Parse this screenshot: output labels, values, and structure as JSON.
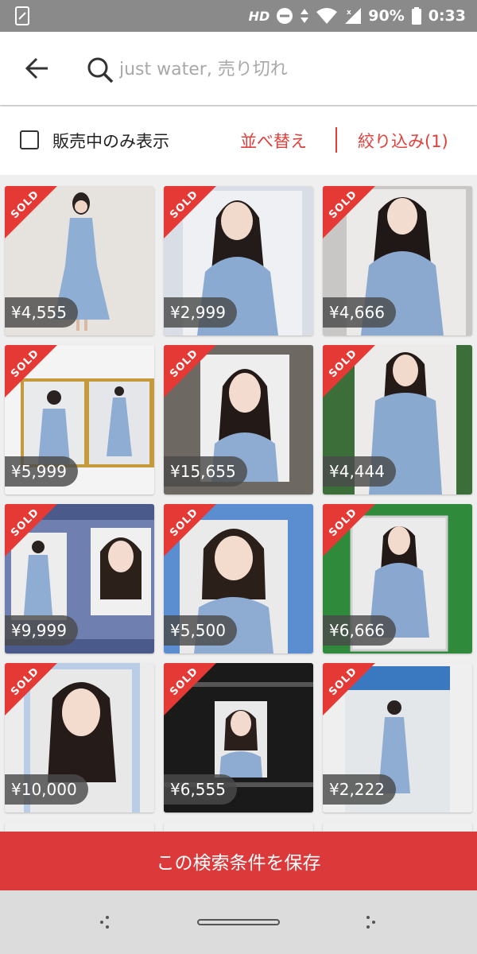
{
  "status_bar": {
    "hd": "HD",
    "battery": "90%",
    "time": "0:33"
  },
  "search": {
    "placeholder": "just water, 売り切れ"
  },
  "filter_bar": {
    "checkbox_label": "販売中のみ表示",
    "sort_label": "並べ替え",
    "filter_label": "絞り込み(1)",
    "accent_color": "#e0403b"
  },
  "items": [
    {
      "sold": "SOLD",
      "price": "¥4,555"
    },
    {
      "sold": "SOLD",
      "price": "¥2,999"
    },
    {
      "sold": "SOLD",
      "price": "¥4,666"
    },
    {
      "sold": "SOLD",
      "price": "¥5,999"
    },
    {
      "sold": "SOLD",
      "price": "¥15,655"
    },
    {
      "sold": "SOLD",
      "price": "¥4,444"
    },
    {
      "sold": "SOLD",
      "price": "¥9,999"
    },
    {
      "sold": "SOLD",
      "price": "¥5,500"
    },
    {
      "sold": "SOLD",
      "price": "¥6,666"
    },
    {
      "sold": "SOLD",
      "price": "¥10,000"
    },
    {
      "sold": "SOLD",
      "price": "¥6,555"
    },
    {
      "sold": "SOLD",
      "price": "¥2,222"
    }
  ],
  "save_search": {
    "label": "この検索条件を保存",
    "color": "#dc3a3a"
  }
}
